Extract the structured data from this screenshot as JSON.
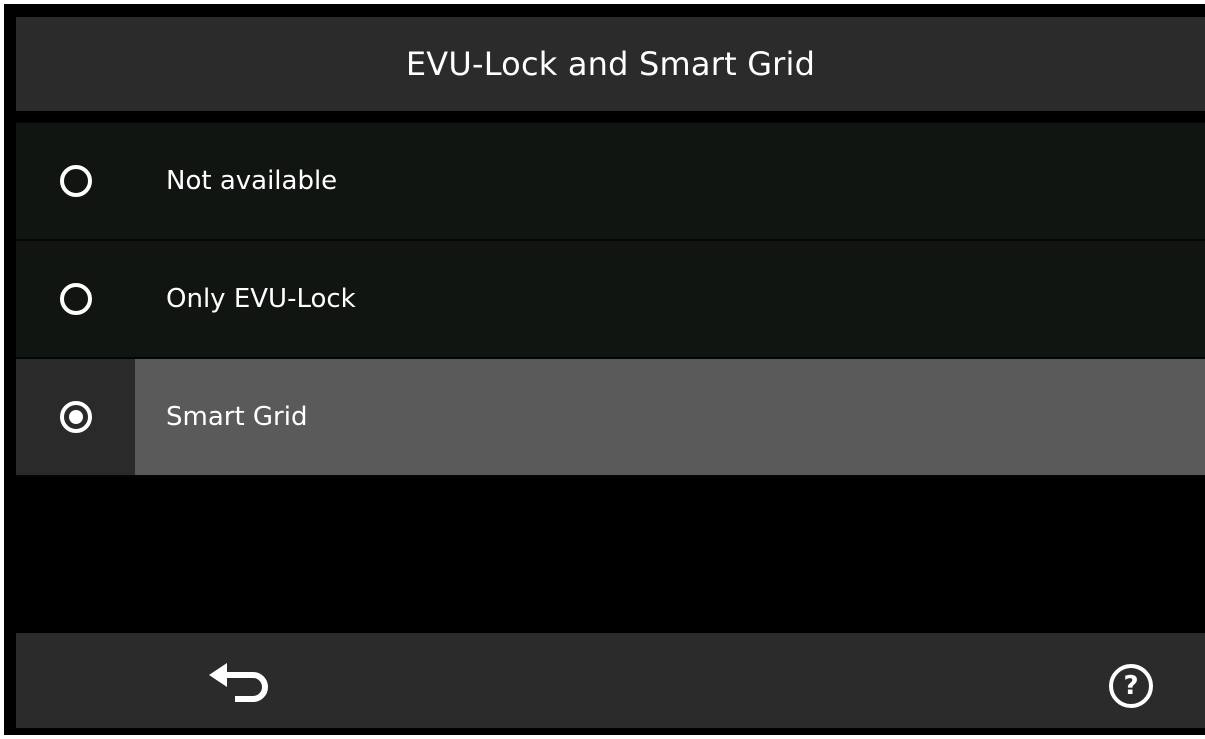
{
  "header": {
    "title": "EVU-Lock and Smart Grid"
  },
  "options": [
    {
      "label": "Not available",
      "selected": false
    },
    {
      "label": "Only EVU-Lock",
      "selected": false
    },
    {
      "label": "Smart Grid",
      "selected": true
    }
  ],
  "footer": {
    "back_icon": "back-arrow-icon",
    "help_icon": "help-icon",
    "help_glyph": "?"
  },
  "colors": {
    "background": "#000000",
    "bar": "#2b2b2b",
    "row": "#111512",
    "selected_row": "#5a5a5a",
    "selected_radio_cell": "#2a2a2a",
    "text": "#ffffff"
  }
}
